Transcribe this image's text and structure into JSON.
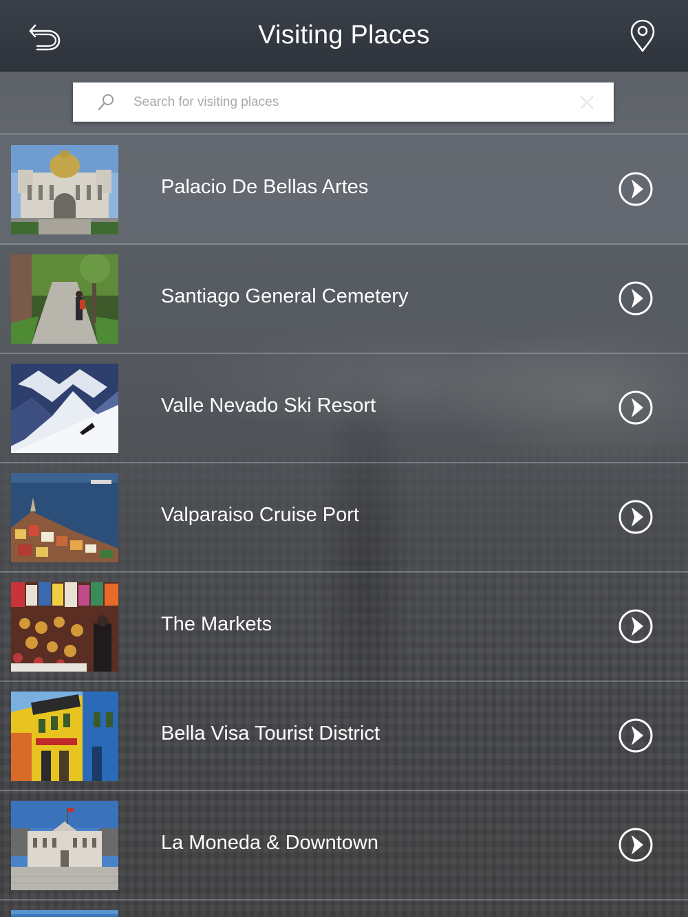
{
  "nav": {
    "title": "Visiting Places",
    "back_icon": "undo-arrow-icon",
    "location_icon": "map-pin-icon"
  },
  "search": {
    "placeholder": "Search for visiting places",
    "value": "",
    "search_icon": "magnifier-icon",
    "clear_icon": "clear-x-icon"
  },
  "places": [
    {
      "label": "Palacio De Bellas Artes",
      "image": "palace-thumbnail"
    },
    {
      "label": "Santiago General Cemetery",
      "image": "cemetery-path-thumbnail"
    },
    {
      "label": "Valle Nevado Ski Resort",
      "image": "ski-slope-thumbnail"
    },
    {
      "label": "Valparaiso Cruise Port",
      "image": "harbor-town-thumbnail"
    },
    {
      "label": "The Markets",
      "image": "market-stall-thumbnail"
    },
    {
      "label": "Bella Visa Tourist District",
      "image": "colorful-buildings-thumbnail"
    },
    {
      "label": "La Moneda & Downtown",
      "image": "government-palace-thumbnail"
    }
  ],
  "colors": {
    "navbar": "#2e333b",
    "search_strip": "#5d6168",
    "text": "#ffffff",
    "divider": "#aab2be"
  }
}
